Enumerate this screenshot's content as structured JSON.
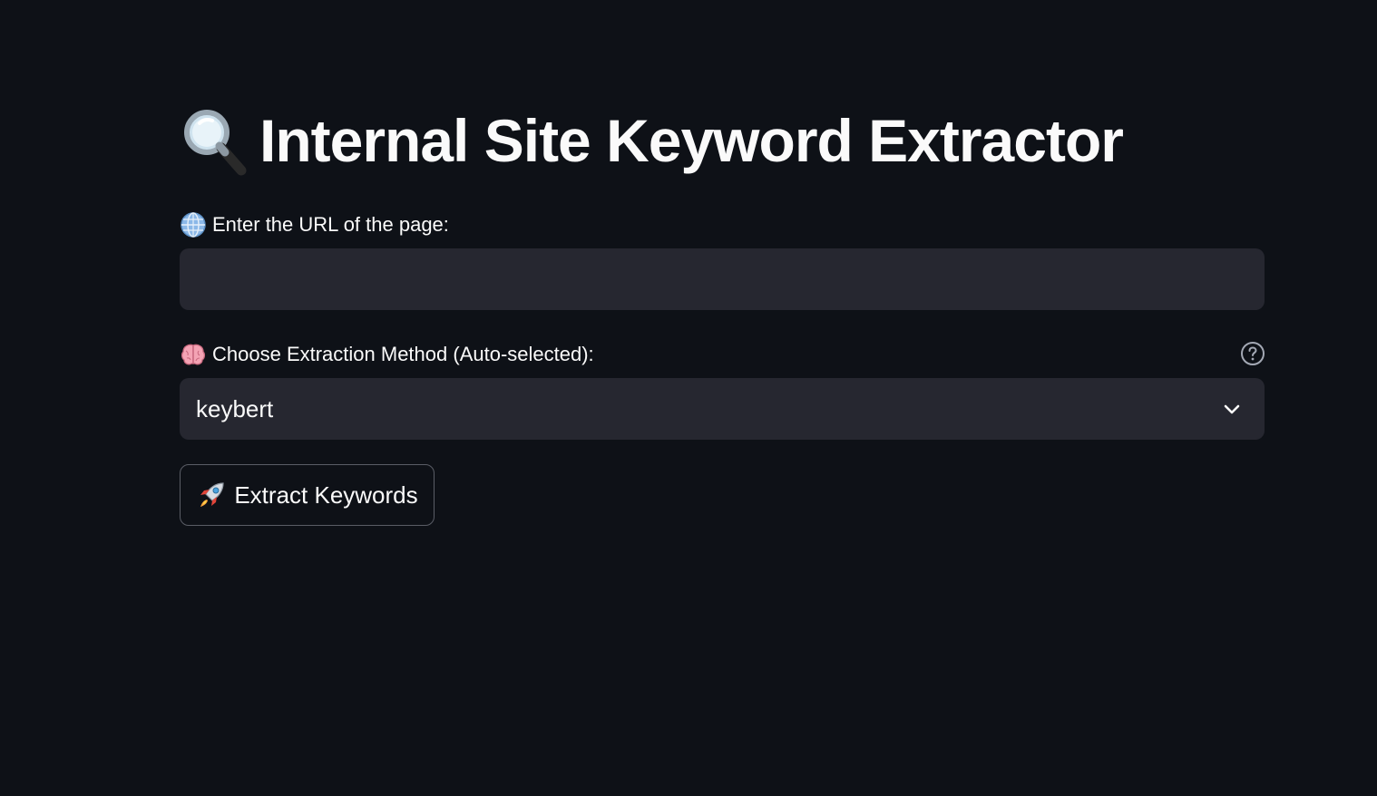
{
  "header": {
    "title": "Internal Site Keyword Extractor",
    "title_icon": "magnifying-glass-icon"
  },
  "url_field": {
    "label": "Enter the URL of the page:",
    "label_icon": "globe-icon",
    "value": "",
    "placeholder": ""
  },
  "method_select": {
    "label": "Choose Extraction Method (Auto-selected):",
    "label_icon": "brain-icon",
    "selected": "keybert",
    "help_icon": "help-circle-icon"
  },
  "extract_button": {
    "label": "Extract Keywords",
    "icon": "rocket-icon"
  },
  "colors": {
    "background": "#0e1117",
    "input_background": "#262730",
    "text": "#fafafa",
    "button_border": "#5a5d66"
  }
}
